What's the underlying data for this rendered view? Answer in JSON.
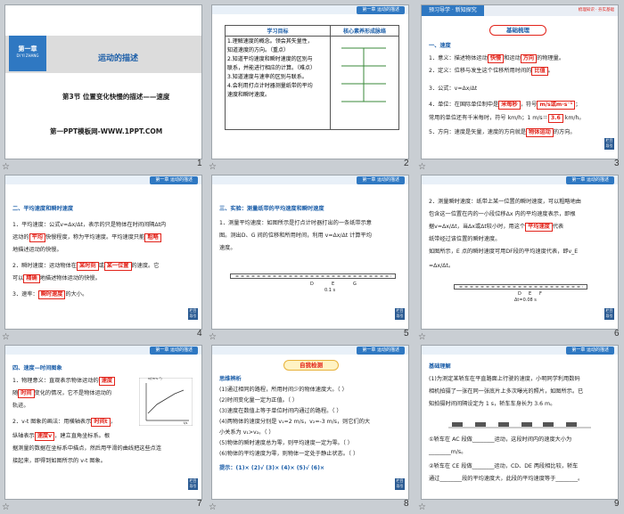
{
  "slides": [
    {
      "num": "1",
      "chapter_badge": "第一章",
      "chapter_en": "DI YI ZHANG",
      "chapter_title": "运动的描述",
      "section_title": "第3节 位置变化快慢的描述——速度",
      "watermark": "第一PPT模板网-WWW.1PPT.COM"
    },
    {
      "num": "2",
      "col1_header": "学习目标",
      "col2_header": "核心素养形成脉络",
      "goals": [
        "1.理解速度的概念。领会其矢量性，",
        "知道速度的方向。（重点）",
        "2.知道平均速度和瞬时速度的区别与",
        "联系，并能进行相应的计算。（难点）",
        "3.知道速度与速率的区别与联系。",
        "4.会利用打点计时器测量纸带的平均",
        "速度和瞬时速度。"
      ]
    },
    {
      "num": "3",
      "banner": "预习导学 · 新知探究",
      "banner_right": "梳理知识 · 夯实基础",
      "title": "基础梳理",
      "heading": "一、速度",
      "l1a": "1．意义：描述物体运动",
      "l1b": "快慢",
      "l1c": "和运动",
      "l1d": "方向",
      "l1e": "的物理量。",
      "l2a": "2．定义：位移与发生这个位移所用时间的",
      "l2b": "比值",
      "l2c": "。",
      "l3a": "3．公式：v=",
      "l3b": "Δx/Δt",
      "l4a": "4．单位：在国际单位制中是",
      "l4b": "米每秒",
      "l4c": "，符号",
      "l4d": "m/s或m·s⁻¹",
      "l4e": "；",
      "l5a": "常用的单位还有千米每时，符号 km/h；1 m/s＝",
      "l5b": "3.6",
      "l5c": " km/h。",
      "l6a": "5．方向：速度是矢量，速度的方向就是",
      "l6b": "物体运动",
      "l6c": "的方向。"
    },
    {
      "num": "4",
      "heading": "二、平均速度和瞬时速度",
      "l1a": "1．平均速度：公式v=Δx/Δt，表示的只是物体在时间间隔Δt内",
      "l2a": "运动的",
      "l2b": "平均",
      "l2c": "快慢程度，称为平均速度。平均速度只能",
      "l2d": "粗略",
      "l3": "地描述运动的快慢。",
      "l4a": "2．瞬时速度：运动物体在",
      "l4b": "某时刻",
      "l4c": "或",
      "l4d": "某一位置",
      "l4e": "的速度。它",
      "l5a": "可以",
      "l5b": "精确",
      "l5c": "地描述物体运动的快慢。",
      "l6a": "3．速率：",
      "l6b": "瞬时速度",
      "l6c": "的大小。"
    },
    {
      "num": "5",
      "heading": "三、实验：测量纸带的平均速度和瞬时速度",
      "l1": "1．测量平均速度：如图所示是打点计时器打出的一条纸带示意",
      "l2": "图。测出D、G 间的位移和所用时间，利用 v=Δx/Δt 计算平均",
      "l3": "速度。",
      "labels": [
        "D",
        "E",
        "G"
      ],
      "dt": "0.1 s"
    },
    {
      "num": "6",
      "l1": "2．测量瞬时速度：纸带上某一位置的瞬时速度，可以粗略地由",
      "l2a": "包含这一位置在内的一小段位移Δx 内的平均速度表示，即根",
      "l3a": "据v=Δx/Δt，当Δx或Δt较小时，用这个",
      "l3b": "平均速度",
      "l3c": "代表",
      "l4": "纸带经过该位置的瞬时速度。",
      "l5": "如图所示，E 点的瞬时速度可用DF段的平均速度代表，即v_E",
      "l6": "=Δx/Δt。",
      "labels": [
        "D",
        "E",
        "F"
      ],
      "dt": "Δt=0.08 s"
    },
    {
      "num": "7",
      "heading": "四、速度—时间图象",
      "l1a": "1．物理意义：直观表示物体运动的",
      "l1b": "速度",
      "l2a": "随",
      "l2b": "时间",
      "l2c": "变化的情况，它不是物体运动的",
      "l3": "轨迹。",
      "l4a": "2．v-t 图象的画法：用横轴表示",
      "l4b": "时间t",
      "l4c": "，",
      "l5a": "纵轴表示",
      "l5b": "速度v",
      "l5c": "，建立直角坐标系。根",
      "l6": "据测量的数据在坐标系中描点，然后用平滑的曲线把这些点连",
      "l7": "接起来，即得到如图所示的 v-t 图象。",
      "axis_y": "v/(m·s⁻¹)",
      "axis_x": "t/s"
    },
    {
      "num": "8",
      "banner": "自我检测",
      "heading": "思维辨析",
      "items": [
        "(1)通过相同的路程，所用时间少的物体速度大。（     ）",
        "(2)时间变化量一定为正值。（     ）",
        "(3)速度在数值上等于单位时间内通过的路程。（     ）",
        "(4)两物体的速度分别是 v₁=2 m/s，v₂=-3 m/s，则它们的大",
        "小关系为 v₁>v₂。（     ）",
        "(5)物体的瞬时速度总为零，则平均速度一定为零。（     ）",
        "(6)物体的平均速度为零，则物体一定处于静止状态。（     ）"
      ],
      "answer": "提示：(1)×   (2)√   (3)×   (4)×   (5)√   (6)×"
    },
    {
      "num": "9",
      "heading": "基础理解",
      "lines": [
        "(1)为测定某轿车在平直路面上行驶的速度，小明同学利用数码",
        "相机拍摄了一张在同一张底片上多次曝光的照片，如图所示。已",
        "知拍摄时间间隔设定为 1 s，轿车车身长为 3.6 m。",
        "①轿车在 AC 段做________运动，这段时间内的速度大小为",
        "________m/s。",
        "②轿车在 CE 段做________运动，CD、DE 两段相比较，轿车",
        "通过________段的平均速度大，此段的平均速度等于________。"
      ]
    },
    {
      "common_tab": "第一章  运动的描述",
      "next_label": "栏目导引"
    }
  ],
  "colors": {
    "accent_blue": "#2f78c2",
    "answer_red": "#e2231a",
    "heading_blue": "#1a5da8"
  }
}
